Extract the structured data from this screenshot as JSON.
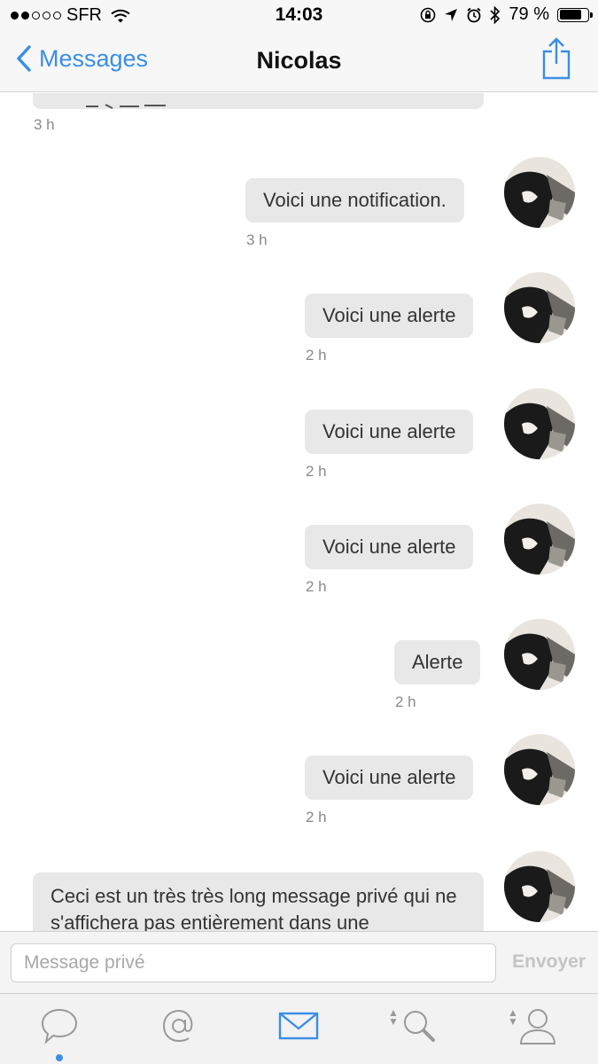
{
  "status_bar": {
    "carrier": "SFR",
    "time": "14:03",
    "battery_text": "79 %",
    "battery_level": 0.79
  },
  "nav": {
    "back_label": "Messages",
    "title": "Nicolas"
  },
  "messages": [
    {
      "text": "",
      "time": "3 h"
    },
    {
      "text": "Voici une notification.",
      "time": "3 h"
    },
    {
      "text": "Voici une alerte",
      "time": "2 h"
    },
    {
      "text": "Voici une alerte",
      "time": "2 h"
    },
    {
      "text": "Voici une alerte",
      "time": "2 h"
    },
    {
      "text": "Alerte",
      "time": "2 h"
    },
    {
      "text": "Voici une alerte",
      "time": "2 h"
    },
    {
      "text": "Ceci est un très très long message privé qui ne s'affichera pas entièrement dans une"
    }
  ],
  "composer": {
    "placeholder": "Message privé",
    "value": "",
    "send_label": "Envoyer"
  },
  "tabs": [
    {
      "icon": "speech-bubble-icon",
      "active_dot": true
    },
    {
      "icon": "at-sign-icon"
    },
    {
      "icon": "envelope-icon",
      "active": true
    },
    {
      "icon": "search-icon"
    },
    {
      "icon": "user-icon"
    }
  ],
  "colors": {
    "accent": "#3a8ee6",
    "bubble": "#e8e8e8",
    "timestamp": "#8a8a8a"
  }
}
